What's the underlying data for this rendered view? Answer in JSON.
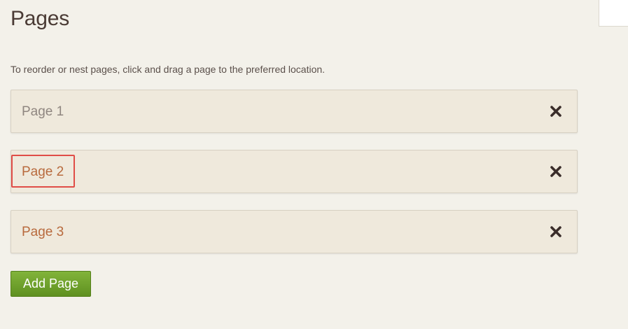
{
  "header": {
    "title": "Pages"
  },
  "help": {
    "text": "To reorder or nest pages, click and drag a page to the preferred location."
  },
  "pages": [
    {
      "label": "Page 1"
    },
    {
      "label": "Page 2"
    },
    {
      "label": "Page 3"
    }
  ],
  "actions": {
    "add_page_label": "Add Page"
  },
  "icons": {
    "delete": "close-icon"
  },
  "colors": {
    "background": "#f3f1ea",
    "item_background": "#efe9dc",
    "link": "#b86a3d",
    "muted_link": "#8f8680",
    "add_button": "#6fa22b",
    "highlight": "#e04d47"
  }
}
